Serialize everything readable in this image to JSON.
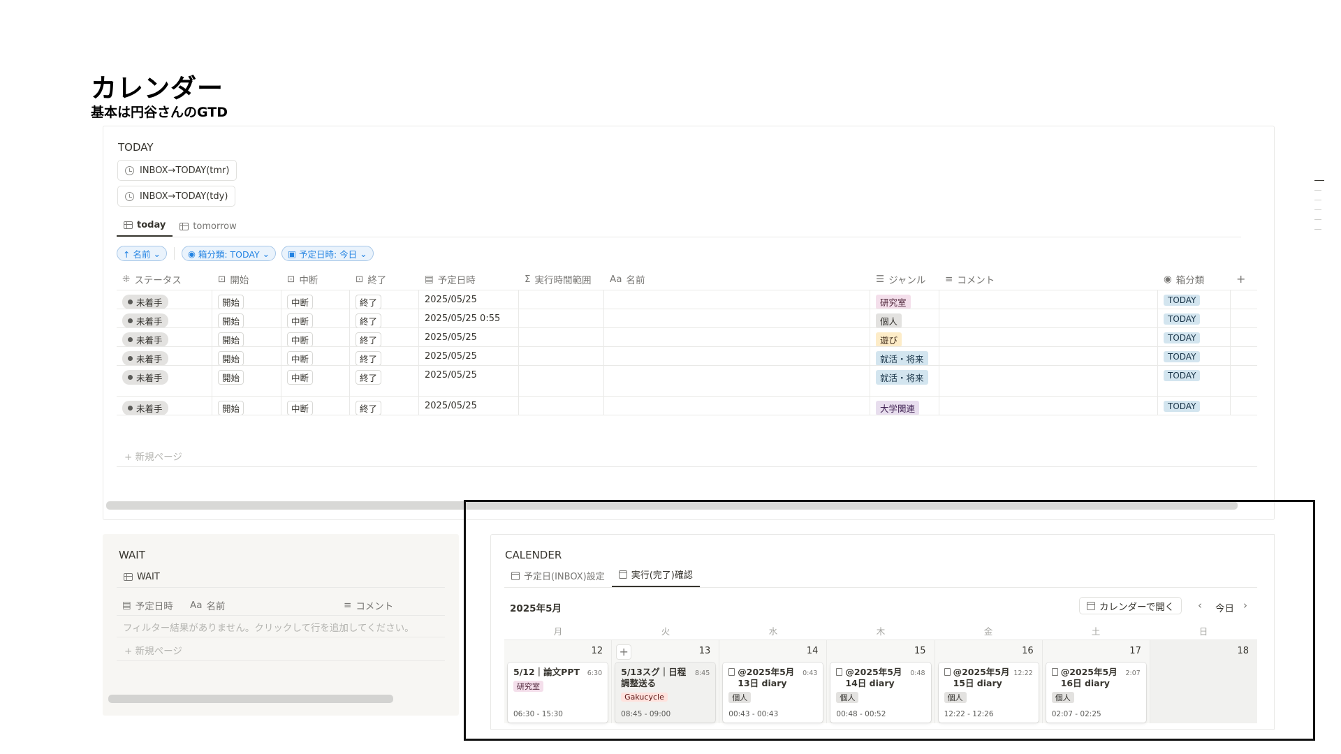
{
  "page": {
    "title": "カレンダー",
    "subtitle": "基本は円谷さんのGTD"
  },
  "today": {
    "label": "TODAY",
    "buttons": [
      "INBOX→TODAY(tmr)",
      "INBOX→TODAY(tdy)"
    ],
    "tabs": [
      "today",
      "tomorrow"
    ],
    "filters": [
      "↑ 名前",
      "箱分類: TODAY",
      "予定日時: 今日"
    ],
    "columns": [
      "ステータス",
      "開始",
      "中断",
      "終了",
      "予定日時",
      "実行時間範囲",
      "名前",
      "ジャンル",
      "コメント",
      "箱分類"
    ],
    "rows": [
      {
        "status": "未着手",
        "start": "開始",
        "pause": "中断",
        "end": "終了",
        "date": "2025/05/25",
        "genre": "研究室",
        "box": "TODAY"
      },
      {
        "status": "未着手",
        "start": "開始",
        "pause": "中断",
        "end": "終了",
        "date": "2025/05/25 0:55",
        "genre": "個人",
        "box": "TODAY"
      },
      {
        "status": "未着手",
        "start": "開始",
        "pause": "中断",
        "end": "終了",
        "date": "2025/05/25",
        "genre": "遊び",
        "box": "TODAY"
      },
      {
        "status": "未着手",
        "start": "開始",
        "pause": "中断",
        "end": "終了",
        "date": "2025/05/25",
        "genre": "就活・将来",
        "box": "TODAY"
      },
      {
        "status": "未着手",
        "start": "開始",
        "pause": "中断",
        "end": "終了",
        "date": "2025/05/25",
        "genre": "就活・将来",
        "box": "TODAY"
      },
      {
        "status": "未着手",
        "start": "開始",
        "pause": "中断",
        "end": "終了",
        "date": "2025/05/25",
        "genre": "大学関連",
        "box": "TODAY"
      }
    ],
    "new_page": "+ 新規ページ"
  },
  "wait": {
    "label": "WAIT",
    "tab": "WAIT",
    "columns": [
      "予定日時",
      "名前",
      "コメント"
    ],
    "empty": "フィルター結果がありません。クリックして行を追加してください。",
    "new_page": "+ 新規ページ"
  },
  "calendar": {
    "label": "CALENDER",
    "tabs": [
      "予定日(INBOX)設定",
      "実行(完了)確認"
    ],
    "month": "2025年5月",
    "open_btn": "カレンダーで開く",
    "today_btn": "今日",
    "weekdays": [
      "月",
      "火",
      "水",
      "木",
      "金",
      "土",
      "日"
    ],
    "days": [
      {
        "num": "12",
        "title": "5/12｜論文PPT",
        "badge": "6:30",
        "tag": "研究室",
        "range": "06:30 - 15:30"
      },
      {
        "num": "13",
        "title": "5/13スグ｜日程調整送る",
        "badge": "8:45",
        "tag": "Gakucycle",
        "range": "08:45 - 09:00"
      },
      {
        "num": "14",
        "title": "@2025年5月13日 diary",
        "badge": "0:43",
        "tag": "個人",
        "range": "00:43 - 00:43"
      },
      {
        "num": "15",
        "title": "@2025年5月14日 diary",
        "badge": "0:48",
        "tag": "個人",
        "range": "00:48 - 00:52"
      },
      {
        "num": "16",
        "title": "@2025年5月15日 diary",
        "badge": "12:22",
        "tag": "個人",
        "range": "12:22 - 12:26"
      },
      {
        "num": "17",
        "title": "@2025年5月16日 diary",
        "badge": "2:07",
        "tag": "個人",
        "range": "02:07 - 02:25"
      },
      {
        "num": "18"
      }
    ]
  },
  "colors": {
    "tag_lab": "#f4dfeb",
    "tag_lab_text": "#4c2337",
    "tag_personal": "#e3e2e0",
    "tag_personal_text": "#32302c",
    "tag_play": "#fdecc8",
    "tag_play_text": "#402c1b",
    "tag_career": "#d3e5ef",
    "tag_career_text": "#183347",
    "tag_univ": "#e8deee",
    "tag_univ_text": "#412454",
    "tag_gaku": "#ffe2dd",
    "tag_gaku_text": "#5d1715",
    "accent_blue": "#2383e2"
  }
}
